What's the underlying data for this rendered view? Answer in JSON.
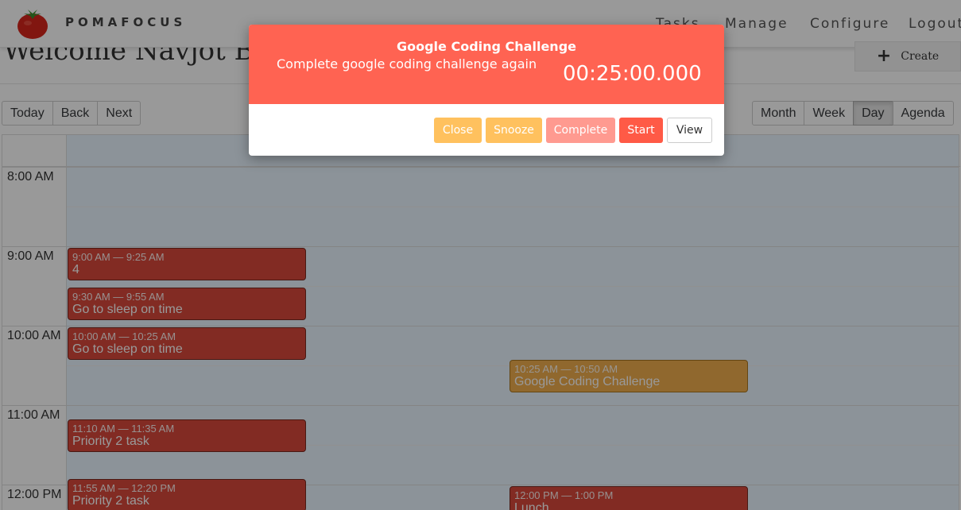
{
  "app": {
    "brand": "POMAFOCUS",
    "nav": [
      "Tasks",
      "Manage",
      "Configure",
      "Logout"
    ],
    "welcome": "Welcome Navjot Bo",
    "create_label": "Create"
  },
  "toolbar": {
    "nav_buttons": [
      "Today",
      "Back",
      "Next"
    ],
    "views": [
      "Month",
      "Week",
      "Day",
      "Agenda"
    ],
    "active_view": "Day"
  },
  "calendar": {
    "hours": [
      "8:00 AM",
      "9:00 AM",
      "10:00 AM",
      "11:00 AM",
      "12:00 PM"
    ],
    "events": [
      {
        "time": "9:00 AM — 9:25 AM",
        "title": "4",
        "color": "#d9493b"
      },
      {
        "time": "9:30 AM — 9:55 AM",
        "title": "Go to sleep on time",
        "color": "#d9493b"
      },
      {
        "time": "10:00 AM — 10:25 AM",
        "title": "Go to sleep on time",
        "color": "#d9493b"
      },
      {
        "time": "10:25 AM — 10:50 AM",
        "title": "Google Coding Challenge",
        "color": "#f0ad4e"
      },
      {
        "time": "11:10 AM — 11:35 AM",
        "title": "Priority 2 task",
        "color": "#d9493b"
      },
      {
        "time": "11:55 AM — 12:20 PM",
        "title": "Priority 2 task",
        "color": "#d9493b"
      },
      {
        "time": "12:00 PM — 1:00 PM",
        "title": "Lunch",
        "color": "#d9493b"
      }
    ]
  },
  "modal": {
    "title": "Google Coding Challenge",
    "description": "Complete google coding challenge again",
    "timer": "00:25:00.000",
    "buttons": {
      "close": "Close",
      "snooze": "Snooze",
      "complete": "Complete",
      "start": "Start",
      "view": "View"
    }
  },
  "colors": {
    "modal_header": "#ff6352",
    "event_red": "#d9493b",
    "event_gold": "#f0ad4e"
  },
  "icons": {
    "logo": "tomato-logo-icon",
    "create": "plus-icon"
  }
}
